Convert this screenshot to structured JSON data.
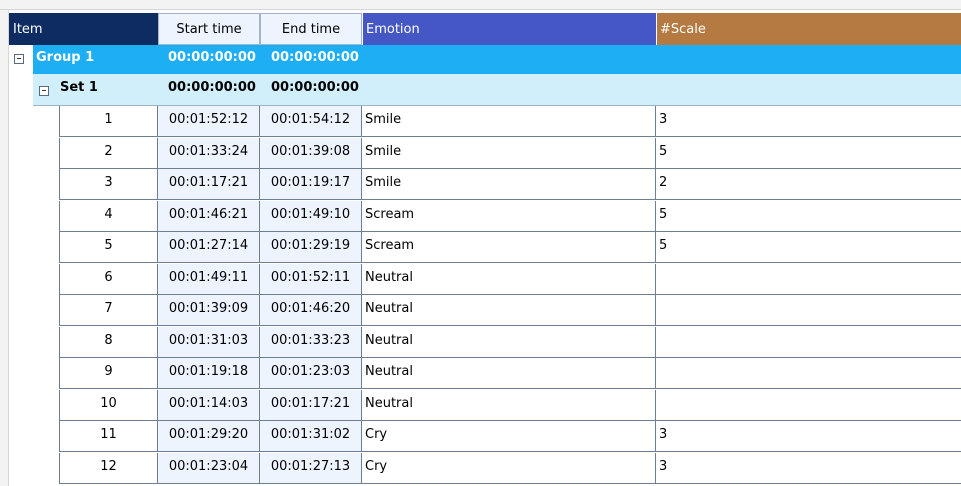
{
  "columns": {
    "item": "Item",
    "start": "Start time",
    "end": "End time",
    "emotion": "Emotion",
    "scale": "#Scale"
  },
  "colors": {
    "item_header": "#0e2c62",
    "emotion_header": "#4556c5",
    "scale_header": "#b57a42",
    "group_row": "#1eaef3",
    "set_row": "#d0effa",
    "time_cell": "#edf4fe"
  },
  "group": {
    "label": "Group  1",
    "start": "00:00:00:00",
    "end": "00:00:00:00"
  },
  "set": {
    "label": "Set  1",
    "start": "00:00:00:00",
    "end": "00:00:00:00"
  },
  "rows": [
    {
      "num": "1",
      "start": "00:01:52:12",
      "end": "00:01:54:12",
      "emotion": "Smile",
      "scale": "3"
    },
    {
      "num": "2",
      "start": "00:01:33:24",
      "end": "00:01:39:08",
      "emotion": "Smile",
      "scale": "5"
    },
    {
      "num": "3",
      "start": "00:01:17:21",
      "end": "00:01:19:17",
      "emotion": "Smile",
      "scale": "2"
    },
    {
      "num": "4",
      "start": "00:01:46:21",
      "end": "00:01:49:10",
      "emotion": "Scream",
      "scale": "5"
    },
    {
      "num": "5",
      "start": "00:01:27:14",
      "end": "00:01:29:19",
      "emotion": "Scream",
      "scale": "5"
    },
    {
      "num": "6",
      "start": "00:01:49:11",
      "end": "00:01:52:11",
      "emotion": "Neutral",
      "scale": ""
    },
    {
      "num": "7",
      "start": "00:01:39:09",
      "end": "00:01:46:20",
      "emotion": "Neutral",
      "scale": ""
    },
    {
      "num": "8",
      "start": "00:01:31:03",
      "end": "00:01:33:23",
      "emotion": "Neutral",
      "scale": ""
    },
    {
      "num": "9",
      "start": "00:01:19:18",
      "end": "00:01:23:03",
      "emotion": "Neutral",
      "scale": ""
    },
    {
      "num": "10",
      "start": "00:01:14:03",
      "end": "00:01:17:21",
      "emotion": "Neutral",
      "scale": ""
    },
    {
      "num": "11",
      "start": "00:01:29:20",
      "end": "00:01:31:02",
      "emotion": "Cry",
      "scale": "3"
    },
    {
      "num": "12",
      "start": "00:01:23:04",
      "end": "00:01:27:13",
      "emotion": "Cry",
      "scale": "3"
    }
  ]
}
